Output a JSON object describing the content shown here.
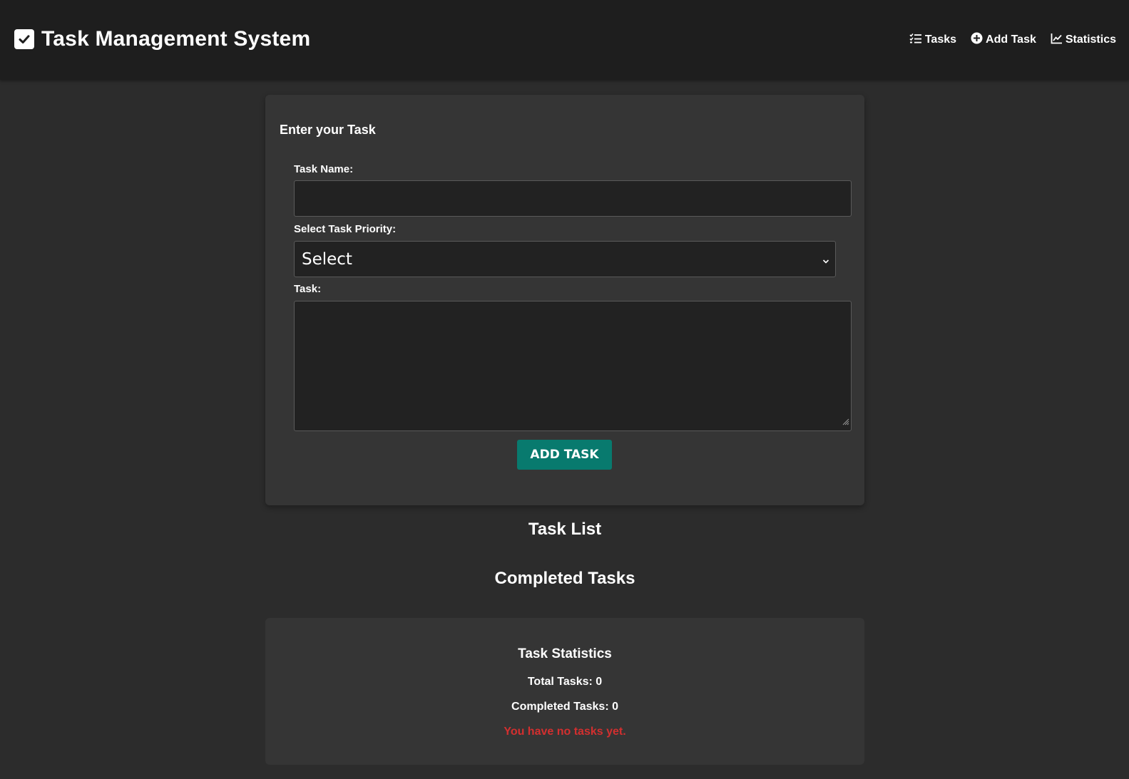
{
  "header": {
    "title": "Task Management System",
    "logo_icon": "check-square-icon",
    "nav": [
      {
        "label": "Tasks",
        "icon": "list-check-icon"
      },
      {
        "label": "Add Task",
        "icon": "plus-circle-icon"
      },
      {
        "label": "Statistics",
        "icon": "chart-line-icon"
      }
    ]
  },
  "form": {
    "heading": "Enter your Task",
    "task_name_label": "Task Name:",
    "task_name_value": "",
    "priority_label": "Select Task Priority:",
    "priority_selected": "Select",
    "task_label": "Task:",
    "task_value": "",
    "submit_label": "ADD TASK"
  },
  "task_list": {
    "title": "Task List"
  },
  "completed": {
    "title": "Completed Tasks"
  },
  "stats": {
    "title": "Task Statistics",
    "total": "Total Tasks: 0",
    "completed": "Completed Tasks: 0",
    "empty_message": "You have no tasks yet."
  },
  "colors": {
    "background": "#2c2c2c",
    "header": "#1e1e1e",
    "card": "#353535",
    "input": "#222222",
    "accent": "#087a6e",
    "error": "#d32f2f"
  }
}
